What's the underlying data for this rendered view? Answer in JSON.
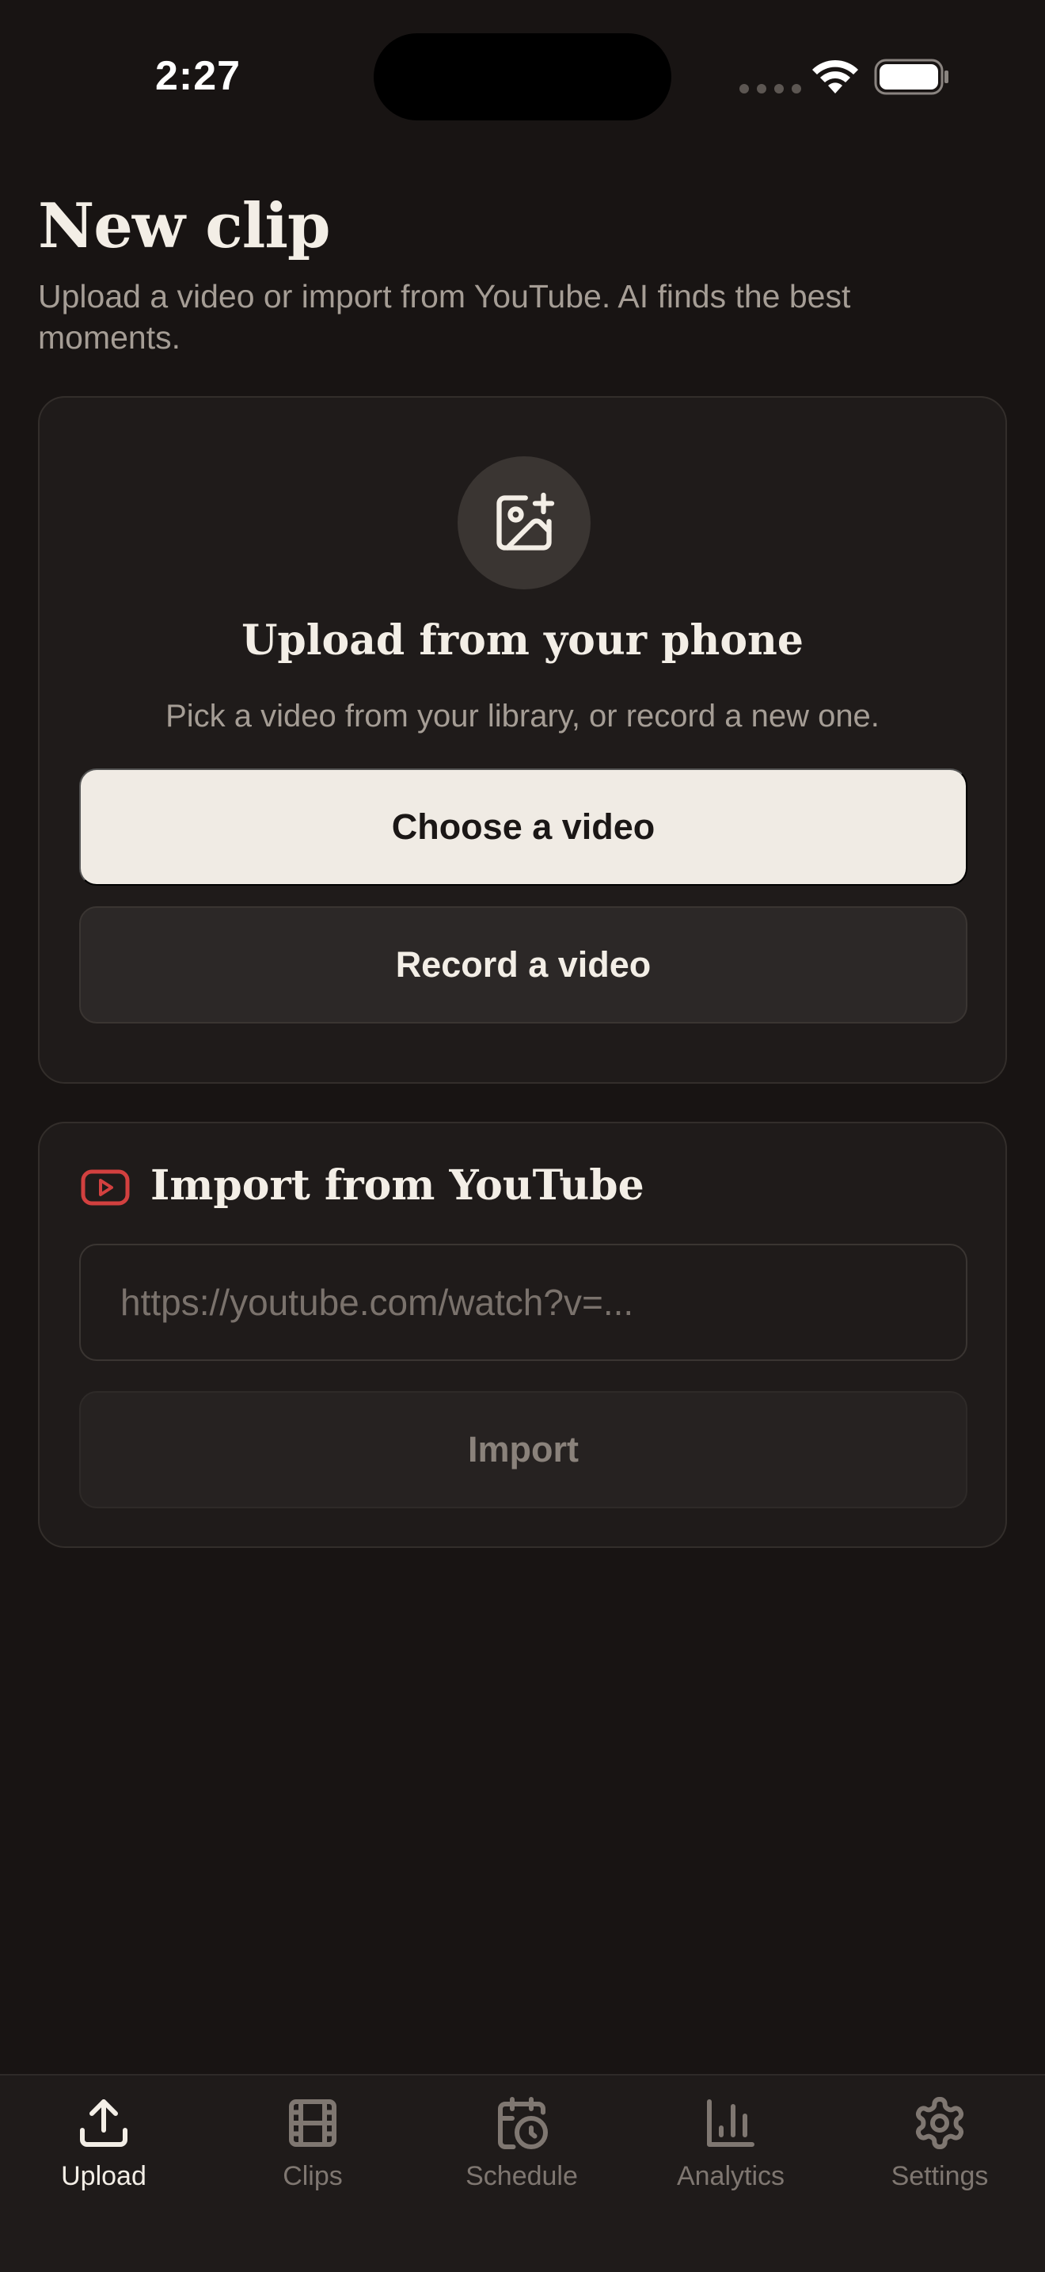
{
  "status_bar": {
    "time": "2:27"
  },
  "header": {
    "title": "New clip",
    "subtitle": "Upload a video or import from YouTube. AI finds the best moments."
  },
  "upload_card": {
    "icon": "image-plus-icon",
    "heading": "Upload from your phone",
    "description": "Pick a video from your library, or record a new one.",
    "choose_label": "Choose a video",
    "record_label": "Record a video"
  },
  "youtube_card": {
    "icon": "youtube-icon",
    "heading": "Import from YouTube",
    "url_value": "",
    "url_placeholder": "https://youtube.com/watch?v=...",
    "import_label": "Import"
  },
  "tab_bar": {
    "items": [
      {
        "label": "Upload",
        "icon": "upload-icon",
        "active": true
      },
      {
        "label": "Clips",
        "icon": "film-icon",
        "active": false
      },
      {
        "label": "Schedule",
        "icon": "calendar-clock-icon",
        "active": false
      },
      {
        "label": "Analytics",
        "icon": "bar-chart-icon",
        "active": false
      },
      {
        "label": "Settings",
        "icon": "gear-icon",
        "active": false
      }
    ]
  },
  "colors": {
    "background": "#181413",
    "card": "#1f1b1a",
    "primary_button": "#f0ebe4",
    "text_primary": "#f3eee6",
    "text_muted": "#a59d95",
    "youtube_red": "#d2403f"
  }
}
